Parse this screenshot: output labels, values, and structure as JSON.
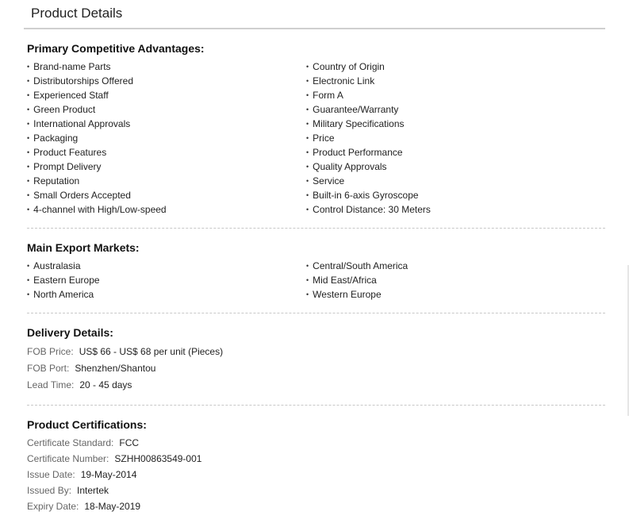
{
  "page_title": "Product Details",
  "advantages": {
    "heading": "Primary Competitive Advantages:",
    "left": [
      "Brand-name Parts",
      "Distributorships Offered",
      "Experienced Staff",
      "Green Product",
      "International Approvals",
      "Packaging",
      "Product Features",
      "Prompt Delivery",
      "Reputation",
      "Small Orders Accepted",
      "4-channel with High/Low-speed"
    ],
    "right": [
      "Country of Origin",
      "Electronic Link",
      "Form A",
      "Guarantee/Warranty",
      "Military Specifications",
      "Price",
      "Product Performance",
      "Quality Approvals",
      "Service",
      "Built-in 6-axis Gyroscope",
      "Control Distance: 30 Meters"
    ]
  },
  "markets": {
    "heading": "Main Export Markets:",
    "left": [
      "Australasia",
      "Eastern Europe",
      "North America"
    ],
    "right": [
      "Central/South America",
      "Mid East/Africa",
      "Western Europe"
    ]
  },
  "delivery": {
    "heading": "Delivery Details:",
    "rows": [
      {
        "label": "FOB Price:",
        "value": "US$ 66 - US$ 68 per unit (Pieces)"
      },
      {
        "label": "FOB Port:",
        "value": "Shenzhen/Shantou"
      },
      {
        "label": "Lead Time:",
        "value": "20 - 45 days"
      }
    ]
  },
  "certifications": {
    "heading": "Product Certifications:",
    "rows": [
      {
        "label": "Certificate Standard:",
        "value": "FCC"
      },
      {
        "label": "Certificate Number:",
        "value": "SZHH00863549-001"
      },
      {
        "label": "Issue Date:",
        "value": "19-May-2014"
      },
      {
        "label": "Issued By:",
        "value": "Intertek"
      },
      {
        "label": "Expiry Date:",
        "value": "18-May-2019"
      }
    ]
  }
}
